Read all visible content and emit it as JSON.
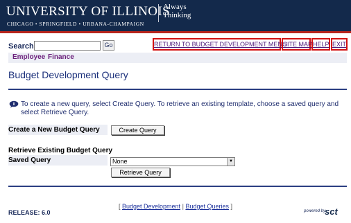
{
  "header": {
    "university": "UNIVERSITY OF ILLINOIS",
    "campuses": "CHICAGO • SPRINGFIELD • URBANA-CHAMPAIGN",
    "tagline_line1": "Always",
    "tagline_line2": "Thinking"
  },
  "search": {
    "label": "Search",
    "value": "",
    "go_label": "Go"
  },
  "top_nav": {
    "return_label": "RETURN TO BUDGET DEVELOPMENT MENU",
    "sitemap_label": "SITE MAP",
    "help_label": "HELP",
    "exit_label": "EXIT"
  },
  "menu": {
    "employee": "Employee",
    "finance": "Finance"
  },
  "page": {
    "title": "Budget Development Query",
    "info": "To create a new query, select Create Query. To retrieve an existing template, choose a saved query and select Retrieve Query."
  },
  "create": {
    "label": "Create a New Budget Query",
    "button": "Create Query"
  },
  "retrieve": {
    "section_label": "Retrieve Existing Budget Query",
    "saved_label": "Saved Query",
    "selected": "None",
    "button": "Retrieve Query"
  },
  "footer": {
    "open_bracket": "[",
    "link1": "Budget Development",
    "separator": "|",
    "link2": "Budget Queries",
    "close_bracket": "]",
    "release": "RELEASE: 6.0",
    "powered_by": "powered by",
    "sct": "sct"
  }
}
